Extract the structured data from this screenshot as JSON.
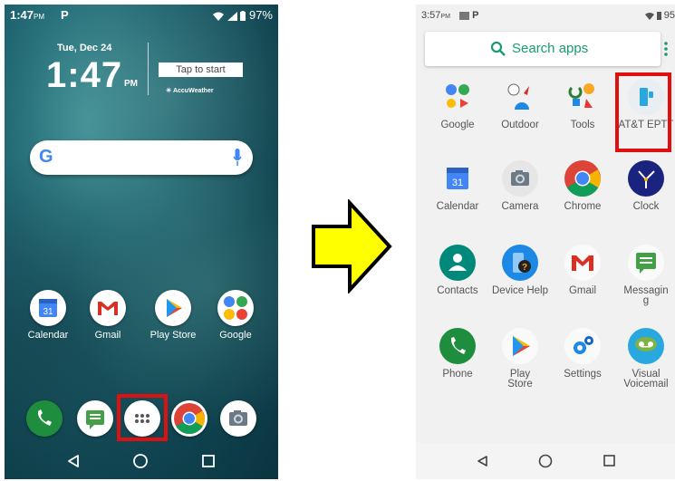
{
  "left_screen": {
    "status": {
      "time": "1:47",
      "ampm": "PM",
      "carrier_icon": "P",
      "battery": "97%"
    },
    "clock_widget": {
      "date": "Tue, Dec 24",
      "time": "1:47",
      "ampm": "PM",
      "tap_label": "Tap to start",
      "weather_brand": "AccuWeather"
    },
    "search_bar": {
      "logo": "G"
    },
    "apps": [
      {
        "label": "Calendar",
        "icon": "calendar-icon"
      },
      {
        "label": "Gmail",
        "icon": "gmail-icon"
      },
      {
        "label": "Play Store",
        "icon": "play-store-icon"
      },
      {
        "label": "Google",
        "icon": "google-folder-icon"
      }
    ],
    "dock": [
      "phone-icon",
      "messages-icon",
      "app-drawer-icon",
      "chrome-icon",
      "camera-icon"
    ]
  },
  "right_screen": {
    "status": {
      "time": "3:57",
      "ampm": "PM",
      "carrier_icon": "P",
      "battery": "95"
    },
    "search": {
      "label": "Search apps"
    },
    "apps": [
      {
        "label": "Google",
        "icon": "google-folder-icon"
      },
      {
        "label": "Outdoor",
        "icon": "outdoor-folder-icon"
      },
      {
        "label": "Tools",
        "icon": "tools-folder-icon"
      },
      {
        "label": "AT&T EPTT",
        "icon": "att-eptt-icon"
      },
      {
        "label": "Calendar",
        "icon": "calendar-icon"
      },
      {
        "label": "Camera",
        "icon": "camera-icon"
      },
      {
        "label": "Chrome",
        "icon": "chrome-icon"
      },
      {
        "label": "Clock",
        "icon": "clock-icon"
      },
      {
        "label": "Contacts",
        "icon": "contacts-icon"
      },
      {
        "label": "Device Help",
        "icon": "device-help-icon"
      },
      {
        "label": "Gmail",
        "icon": "gmail-icon"
      },
      {
        "label": "Messaging",
        "icon": "messaging-icon"
      },
      {
        "label": "Phone",
        "icon": "phone-icon"
      },
      {
        "label": "Play Store",
        "icon": "play-store-icon"
      },
      {
        "label": "Settings",
        "icon": "settings-icon"
      },
      {
        "label": "Visual Voicemail",
        "icon": "visual-voicemail-icon"
      }
    ]
  },
  "colors": {
    "highlight": "#e01010",
    "arrow_fill": "#ffff00",
    "search_accent": "#1a9c6e"
  }
}
